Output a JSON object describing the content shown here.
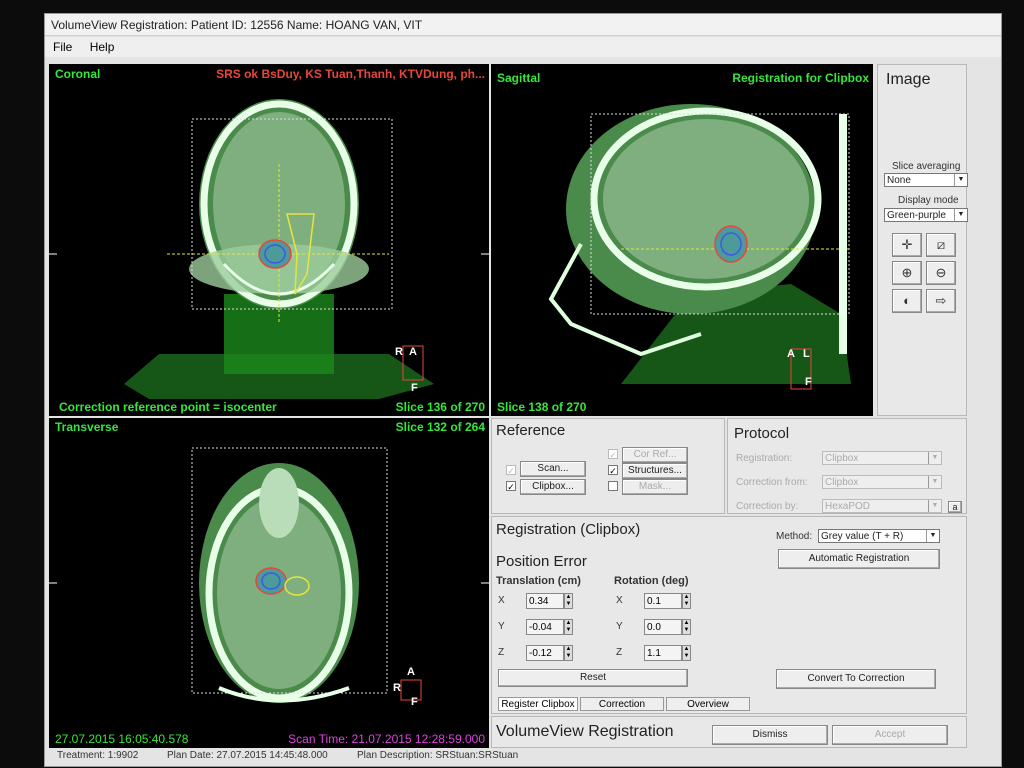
{
  "window": {
    "title": "VolumeView Registration: Patient ID: 12556   Name: HOANG VAN, VIT",
    "menu": [
      "File",
      "Help"
    ]
  },
  "views": {
    "coronal": {
      "name": "Coronal",
      "top_right": "SRS ok BsDuy, KS Tuan,Thanh, KTVDung, ph...",
      "bottom_left": "Correction reference point = isocenter",
      "slice": "Slice 136 of 270",
      "orient": [
        "R",
        "A",
        "F"
      ]
    },
    "sagittal": {
      "name": "Sagittal",
      "top_right": "Registration for Clipbox",
      "slice": "Slice 138 of 270",
      "orient": [
        "A",
        "L",
        "F"
      ]
    },
    "transverse": {
      "name": "Transverse",
      "slice": "Slice 132 of 264",
      "timestamp": "27.07.2015 16:05:40.578",
      "scan_time": "Scan Time: 21.07.2015 12:28:59.000",
      "orient": [
        "A",
        "R",
        "F"
      ]
    }
  },
  "image_panel": {
    "title": "Image",
    "slice_avg_label": "Slice averaging",
    "slice_avg_value": "None",
    "display_mode_label": "Display mode",
    "display_mode_value": "Green-purple",
    "tools": [
      "crosshair-icon",
      "split-icon",
      "zoom-in-icon",
      "zoom-out-icon",
      "contrast-icon",
      "pointer-icon"
    ]
  },
  "reference": {
    "title": "Reference",
    "scan": "Scan...",
    "clipbox": "Clipbox...",
    "cor_ref": "Cor Ref...",
    "structures": "Structures...",
    "mask": "Mask..."
  },
  "protocol": {
    "title": "Protocol",
    "registration_label": "Registration:",
    "registration_value": "Clipbox",
    "correction_from_label": "Correction from:",
    "correction_from_value": "Clipbox",
    "correction_by_label": "Correction by:",
    "correction_by_value": "HexaPOD",
    "lock": "a"
  },
  "registration": {
    "title": "Registration (Clipbox)",
    "method_label": "Method:",
    "method_value": "Grey value (T + R)",
    "auto_button": "Automatic Registration",
    "position_error": "Position Error",
    "translation_label": "Translation (cm)",
    "rotation_label": "Rotation (deg)",
    "translation": [
      {
        "axis": "X",
        "value": "0.34"
      },
      {
        "axis": "Y",
        "value": "-0.04"
      },
      {
        "axis": "Z",
        "value": "-0.12"
      }
    ],
    "rotation": [
      {
        "axis": "X",
        "value": "0.1"
      },
      {
        "axis": "Y",
        "value": "0.0"
      },
      {
        "axis": "Z",
        "value": "1.1"
      }
    ],
    "reset": "Reset",
    "convert": "Convert To Correction"
  },
  "tabs": [
    "Register Clipbox",
    "Correction",
    "Overview"
  ],
  "footer": {
    "title": "VolumeView Registration",
    "dismiss": "Dismiss",
    "accept": "Accept"
  },
  "status": {
    "treatment": "Treatment: 1:9902",
    "plan_date": "Plan Date: 27.07.2015 14:45:48.000",
    "plan_desc": "Plan Description: SRStuan:SRStuan"
  },
  "colors": {
    "overlay_green": "#36e63b",
    "overlay_red": "#e8463a",
    "overlay_magenta": "#e040e0"
  }
}
